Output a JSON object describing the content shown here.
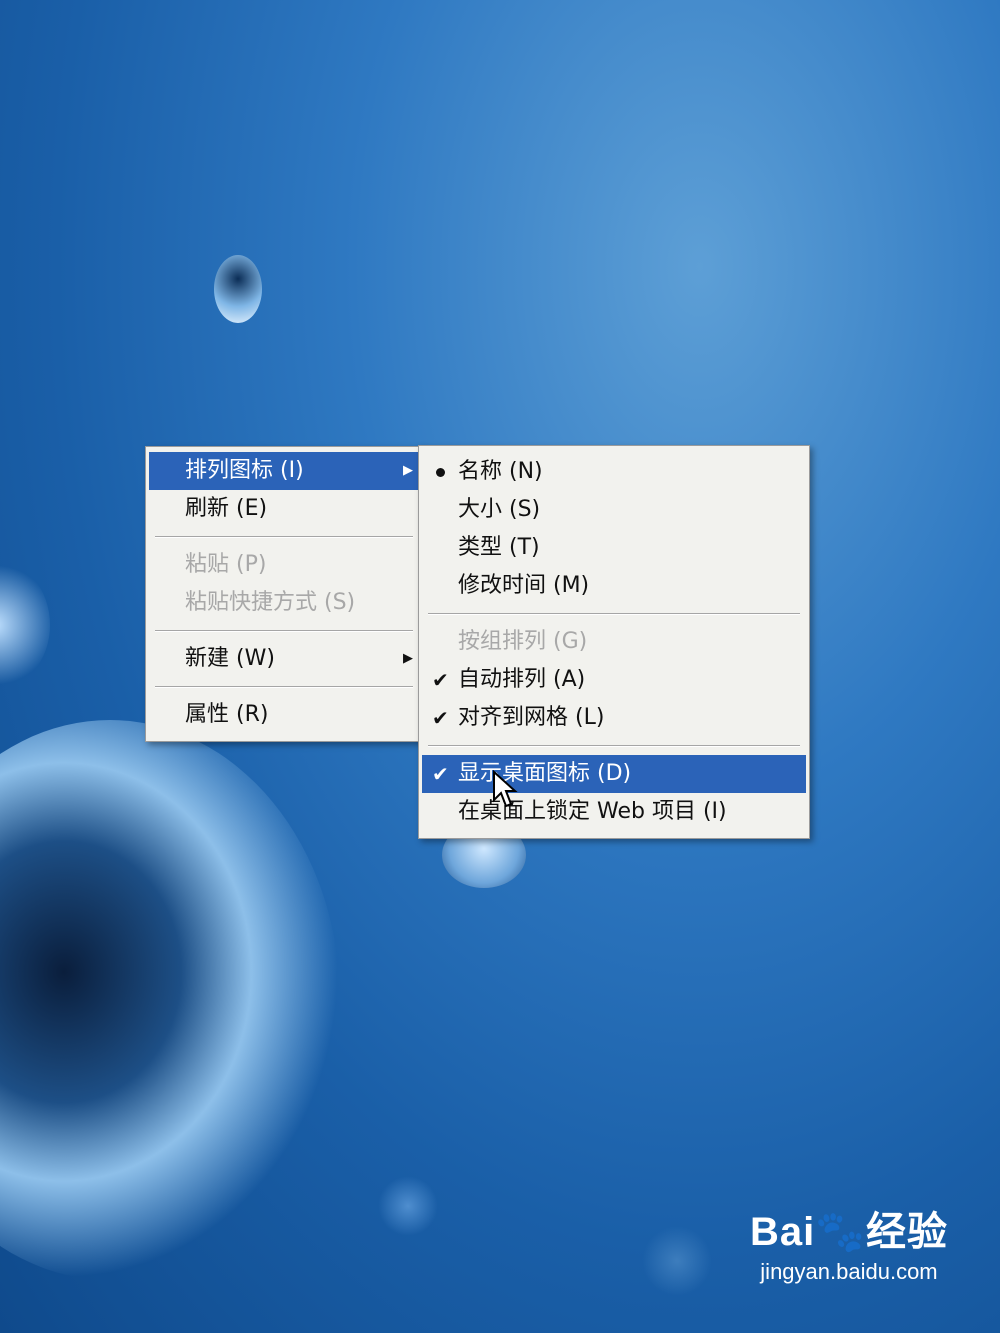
{
  "context_menu": {
    "items": [
      {
        "label": "排列图标 (I)",
        "state": "highlighted",
        "submenu": true
      },
      {
        "label": "刷新 (E)",
        "state": "normal"
      },
      {
        "label": "粘贴 (P)",
        "state": "disabled"
      },
      {
        "label": "粘贴快捷方式 (S)",
        "state": "disabled"
      },
      {
        "label": "新建 (W)",
        "state": "normal",
        "submenu": true
      },
      {
        "label": "属性 (R)",
        "state": "normal"
      }
    ]
  },
  "submenu": {
    "items": [
      {
        "label": "名称 (N)",
        "mark": "bullet"
      },
      {
        "label": "大小 (S)"
      },
      {
        "label": "类型 (T)"
      },
      {
        "label": "修改时间 (M)"
      },
      {
        "label": "按组排列 (G)",
        "state": "disabled"
      },
      {
        "label": "自动排列 (A)",
        "mark": "check"
      },
      {
        "label": "对齐到网格 (L)",
        "mark": "check"
      },
      {
        "label": "显示桌面图标 (D)",
        "mark": "check",
        "state": "highlighted"
      },
      {
        "label": "在桌面上锁定 Web 项目 (I)"
      }
    ]
  },
  "icons": {
    "check": "✔",
    "arrow": "▶"
  },
  "watermark": {
    "logo": "Bai🐾经验",
    "url": "jingyan.baidu.com"
  },
  "colors": {
    "highlight": "#2b63b8",
    "menu_bg": "#f2f2ee",
    "disabled": "#a8a8a8"
  }
}
